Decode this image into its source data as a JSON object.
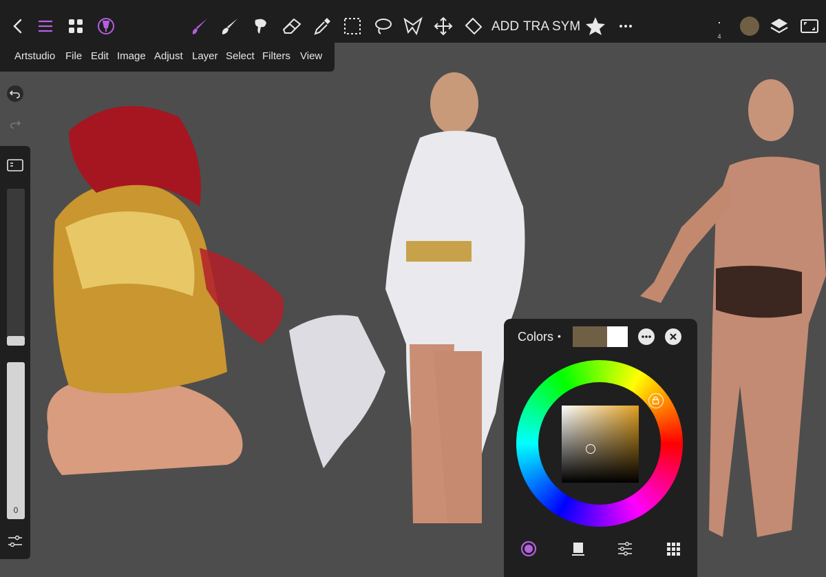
{
  "toolbar": {
    "text_tools": [
      "ADD",
      "TRA",
      "SYM"
    ],
    "brush_size": "4",
    "icons": [
      "back-icon",
      "hamburger-icon",
      "apps-grid-icon",
      "brush-library-icon",
      "paint-brush-icon",
      "smudge-icon",
      "blur-icon",
      "eraser-icon",
      "eyedropper-icon",
      "rect-select-icon",
      "lasso-icon",
      "polygon-select-icon",
      "move-icon",
      "fill-icon",
      "favorite-star-icon",
      "more-icon",
      "layers-icon",
      "fullscreen-icon"
    ],
    "active_color": "#6f5f45"
  },
  "menu": {
    "items": [
      "Artstudio",
      "File",
      "Edit",
      "Image",
      "Adjust",
      "Layer",
      "Select",
      "Filters",
      "View"
    ]
  },
  "sidebar": {
    "size_level": 0.06,
    "opacity_level": 1.0,
    "opacity_value": "0"
  },
  "colors_panel": {
    "title": "Colors",
    "dot": "•",
    "primary_color": "#6f5f45",
    "secondary_color": "#ffffff",
    "hue_color": "#e0a020",
    "tabs": [
      "wheel-tab-icon",
      "swatch-tab-icon",
      "sliders-tab-icon",
      "palette-grid-tab-icon"
    ]
  },
  "accent": "#b560e0"
}
